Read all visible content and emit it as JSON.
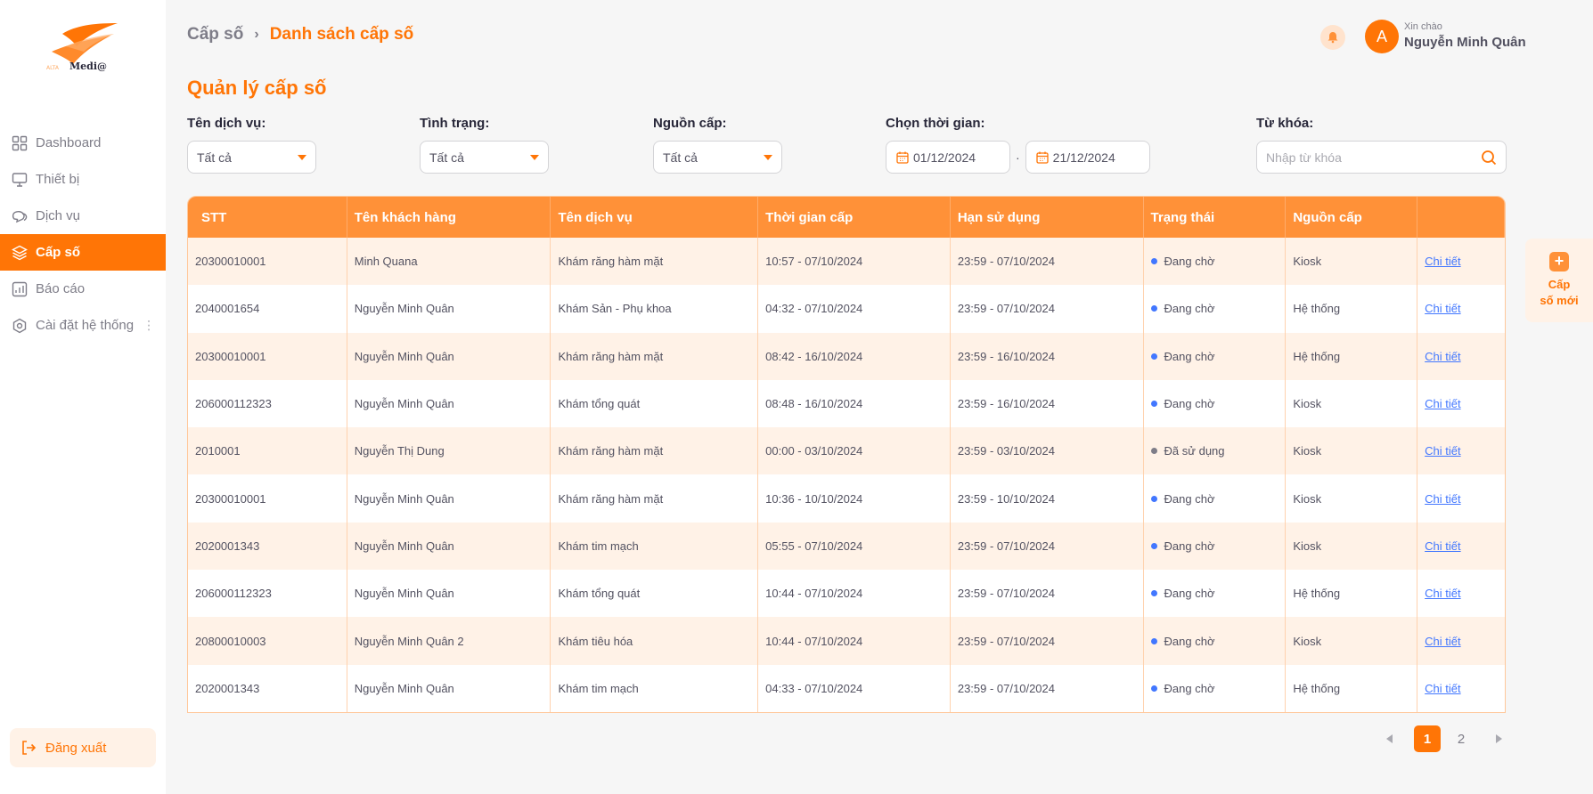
{
  "sidebar": {
    "logo_text": "ALTA Medi@",
    "items": [
      {
        "label": "Dashboard",
        "icon": "dashboard-icon",
        "active": false
      },
      {
        "label": "Thiết bị",
        "icon": "monitor-icon",
        "active": false
      },
      {
        "label": "Dịch vụ",
        "icon": "chat-icon",
        "active": false
      },
      {
        "label": "Cấp số",
        "icon": "layers-icon",
        "active": true
      },
      {
        "label": "Báo cáo",
        "icon": "report-icon",
        "active": false
      },
      {
        "label": "Cài đặt hệ thống",
        "icon": "settings-icon",
        "active": false
      }
    ],
    "more_glyph": "⋮",
    "logout_label": "Đăng xuất"
  },
  "header": {
    "breadcrumb_parent": "Cấp số",
    "breadcrumb_sep": "›",
    "breadcrumb_current": "Danh sách cấp số",
    "greeting": "Xin chào",
    "user_name": "Nguyễn Minh Quân",
    "avatar_letter": "A"
  },
  "page_title": "Quản lý cấp số",
  "filters": {
    "service": {
      "label": "Tên dịch vụ:",
      "value": "Tất cả"
    },
    "status": {
      "label": "Tình trạng:",
      "value": "Tất cả"
    },
    "source": {
      "label": "Nguồn cấp:",
      "value": "Tất cả"
    },
    "time": {
      "label": "Chọn thời gian:",
      "from": "01/12/2024",
      "to": "21/12/2024",
      "sep": "·"
    },
    "keyword": {
      "label": "Từ khóa:",
      "placeholder": "Nhập từ khóa"
    }
  },
  "table": {
    "headers": [
      "STT",
      "Tên khách hàng",
      "Tên dịch vụ",
      "Thời gian cấp",
      "Hạn sử dụng",
      "Trạng thái",
      "Nguồn cấp",
      ""
    ],
    "rows": [
      {
        "stt": "20300010001",
        "customer": "Minh Quana",
        "service": "Khám răng hàm mặt",
        "issued": "10:57 - 07/10/2024",
        "expiry": "23:59 - 07/10/2024",
        "status": "Đang chờ",
        "status_color": "#4277ff",
        "source": "Kiosk",
        "action": "Chi tiết"
      },
      {
        "stt": "2040001654",
        "customer": "Nguyễn Minh Quân",
        "service": "Khám Sản - Phụ khoa",
        "issued": "04:32 - 07/10/2024",
        "expiry": "23:59 - 07/10/2024",
        "status": "Đang chờ",
        "status_color": "#4277ff",
        "source": "Hệ thống",
        "action": "Chi tiết"
      },
      {
        "stt": "20300010001",
        "customer": "Nguyễn Minh Quân",
        "service": "Khám răng hàm mặt",
        "issued": "08:42 - 16/10/2024",
        "expiry": "23:59 - 16/10/2024",
        "status": "Đang chờ",
        "status_color": "#4277ff",
        "source": "Hệ thống",
        "action": "Chi tiết"
      },
      {
        "stt": "206000112323",
        "customer": "Nguyễn Minh Quân",
        "service": "Khám tổng quát",
        "issued": "08:48 - 16/10/2024",
        "expiry": "23:59 - 16/10/2024",
        "status": "Đang chờ",
        "status_color": "#4277ff",
        "source": "Kiosk",
        "action": "Chi tiết"
      },
      {
        "stt": "2010001",
        "customer": "Nguyễn Thị Dung",
        "service": "Khám răng hàm mặt",
        "issued": "00:00 - 03/10/2024",
        "expiry": "23:59 - 03/10/2024",
        "status": "Đã sử dụng",
        "status_color": "#7e7d88",
        "source": "Kiosk",
        "action": "Chi tiết"
      },
      {
        "stt": "20300010001",
        "customer": "Nguyễn Minh Quân",
        "service": "Khám răng hàm mặt",
        "issued": "10:36 - 10/10/2024",
        "expiry": "23:59 - 10/10/2024",
        "status": "Đang chờ",
        "status_color": "#4277ff",
        "source": "Kiosk",
        "action": "Chi tiết"
      },
      {
        "stt": "2020001343",
        "customer": "Nguyễn Minh Quân",
        "service": "Khám tim mạch",
        "issued": "05:55 - 07/10/2024",
        "expiry": "23:59 - 07/10/2024",
        "status": "Đang chờ",
        "status_color": "#4277ff",
        "source": "Kiosk",
        "action": "Chi tiết"
      },
      {
        "stt": "206000112323",
        "customer": "Nguyễn Minh Quân",
        "service": "Khám tổng quát",
        "issued": "10:44 - 07/10/2024",
        "expiry": "23:59 - 07/10/2024",
        "status": "Đang chờ",
        "status_color": "#4277ff",
        "source": "Hệ thống",
        "action": "Chi tiết"
      },
      {
        "stt": "20800010003",
        "customer": "Nguyễn Minh Quân 2",
        "service": "Khám tiêu hóa",
        "issued": "10:44 - 07/10/2024",
        "expiry": "23:59 - 07/10/2024",
        "status": "Đang chờ",
        "status_color": "#4277ff",
        "source": "Kiosk",
        "action": "Chi tiết"
      },
      {
        "stt": "2020001343",
        "customer": "Nguyễn Minh Quân",
        "service": "Khám tim mạch",
        "issued": "04:33 - 07/10/2024",
        "expiry": "23:59 - 07/10/2024",
        "status": "Đang chờ",
        "status_color": "#4277ff",
        "source": "Hệ thống",
        "action": "Chi tiết"
      }
    ]
  },
  "pagination": {
    "pages": [
      "1",
      "2"
    ],
    "current": "1"
  },
  "add_button": {
    "icon": "+",
    "label_line1": "Cấp",
    "label_line2": "số mới"
  },
  "colors": {
    "accent": "#ff7506",
    "header_bg": "#ff9138",
    "row_alt": "#fff2e7",
    "link": "#4277ff"
  }
}
